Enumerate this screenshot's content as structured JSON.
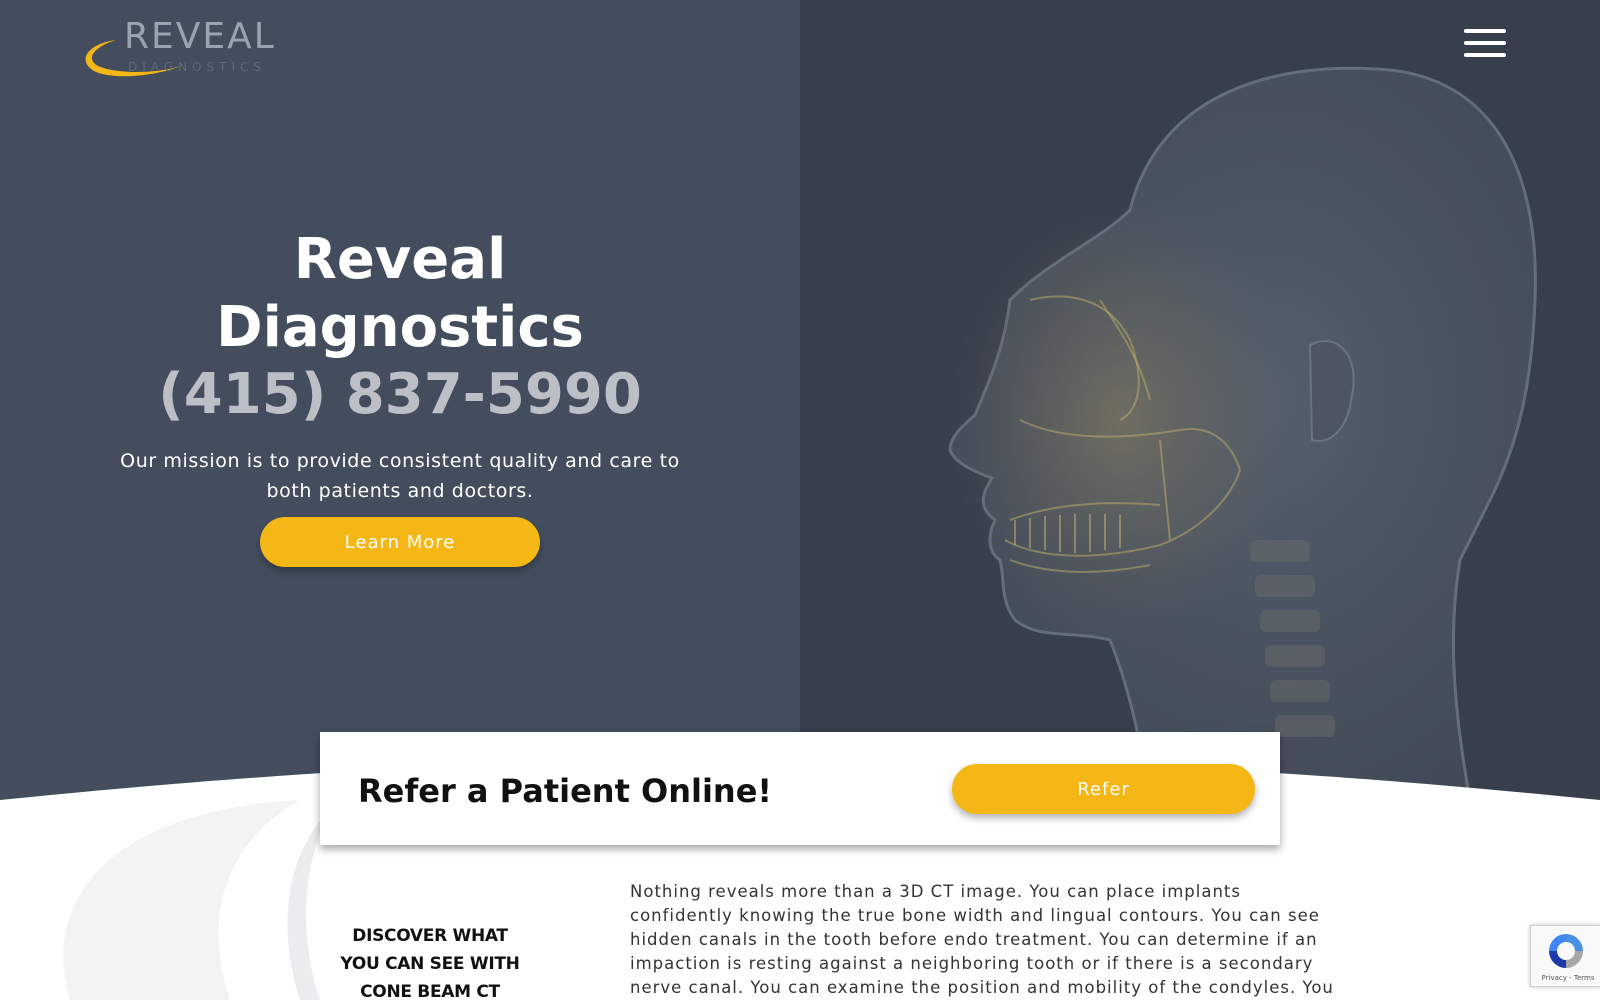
{
  "brand": {
    "logo_word": "REVEAL",
    "logo_sub": "DIAGNOSTICS"
  },
  "hero": {
    "title_line1": "Reveal",
    "title_line2": "Diagnostics",
    "phone": "(415) 837-5990",
    "mission": "Our mission is to provide consistent quality and care to both patients and doctors.",
    "cta_label": "Learn More"
  },
  "refer": {
    "title": "Refer a Patient Online!",
    "button_label": "Refer"
  },
  "discover": {
    "heading_line1": "DISCOVER WHAT",
    "heading_line2": "YOU CAN SEE WITH",
    "heading_line3": "CONE BEAM CT"
  },
  "body": {
    "paragraph": "Nothing reveals more than a 3D CT image. You can place implants confidently knowing the true bone width and lingual contours. You can see hidden canals in the tooth before endo treatment. You can determine if an impaction is resting against a neighboring tooth or if there is a secondary nerve canal. You can examine the position and mobility of the condyles. You can determine"
  },
  "recaptcha": {
    "links": "Privacy - Terms"
  },
  "colors": {
    "hero_left": "#434d5d",
    "hero_right": "#373e4c",
    "accent": "#f5b716"
  },
  "icons": {
    "menu": "hamburger-icon",
    "recaptcha": "recaptcha-icon"
  }
}
